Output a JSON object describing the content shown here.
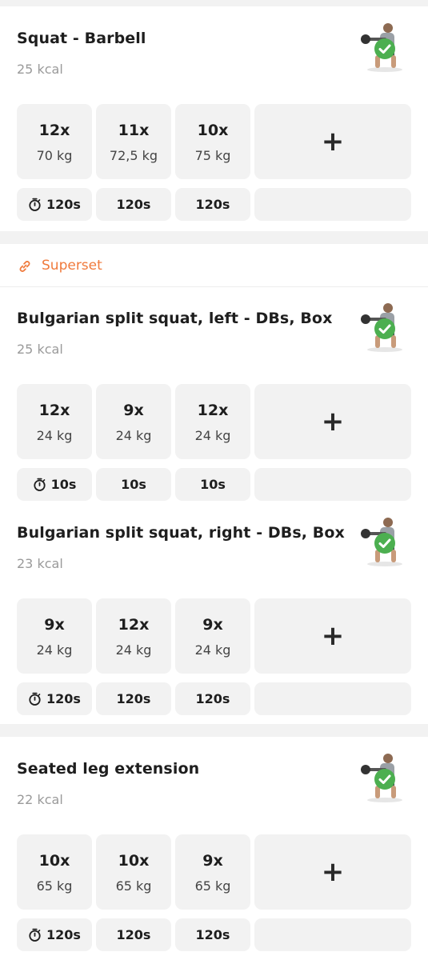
{
  "superset_label": "Superset",
  "colors": {
    "accent": "#f07a3c",
    "tile": "#f2f2f2",
    "check": "#4caf50"
  },
  "exercises": [
    {
      "title": "Squat - Barbell",
      "kcal": "25 kcal",
      "sets": [
        {
          "reps": "12x",
          "weight": "70 kg"
        },
        {
          "reps": "11x",
          "weight": "72,5 kg"
        },
        {
          "reps": "10x",
          "weight": "75 kg"
        }
      ],
      "rests": [
        "120s",
        "120s",
        "120s"
      ],
      "add_symbol": "+",
      "thumb_icon": "barbell-squat-figure"
    },
    {
      "title": "Bulgarian split squat, left - DBs, Box",
      "kcal": "25 kcal",
      "sets": [
        {
          "reps": "12x",
          "weight": "24 kg"
        },
        {
          "reps": "9x",
          "weight": "24 kg"
        },
        {
          "reps": "12x",
          "weight": "24 kg"
        }
      ],
      "rests": [
        "10s",
        "10s",
        "10s"
      ],
      "add_symbol": "+",
      "thumb_icon": "split-squat-figure"
    },
    {
      "title": "Bulgarian split squat, right - DBs, Box",
      "kcal": "23 kcal",
      "sets": [
        {
          "reps": "9x",
          "weight": "24 kg"
        },
        {
          "reps": "12x",
          "weight": "24 kg"
        },
        {
          "reps": "9x",
          "weight": "24 kg"
        }
      ],
      "rests": [
        "120s",
        "120s",
        "120s"
      ],
      "add_symbol": "+",
      "thumb_icon": "split-squat-figure"
    },
    {
      "title": "Seated leg extension",
      "kcal": "22 kcal",
      "sets": [
        {
          "reps": "10x",
          "weight": "65 kg"
        },
        {
          "reps": "10x",
          "weight": "65 kg"
        },
        {
          "reps": "9x",
          "weight": "65 kg"
        }
      ],
      "rests": [
        "120s",
        "120s",
        "120s"
      ],
      "add_symbol": "+",
      "thumb_icon": "leg-extension-machine-figure"
    }
  ]
}
